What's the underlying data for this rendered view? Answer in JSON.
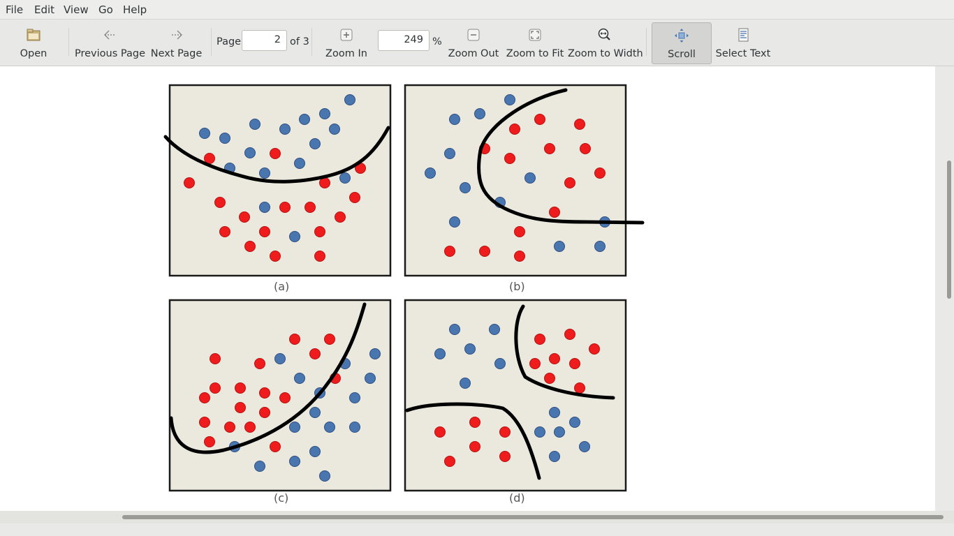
{
  "menu": {
    "items": [
      "File",
      "Edit",
      "View",
      "Go",
      "Help"
    ]
  },
  "toolbar": {
    "open": "Open",
    "prev_page": "Previous Page",
    "next_page": "Next Page",
    "page_label": "Page",
    "page_value": "2",
    "page_of": "of 3",
    "zoom_in": "Zoom In",
    "zoom_value": "249",
    "zoom_unit": "%",
    "zoom_out": "Zoom Out",
    "zoom_fit": "Zoom to Fit",
    "zoom_width": "Zoom to Width",
    "scroll": "Scroll",
    "select_text": "Select Text"
  },
  "figure": {
    "colors": {
      "blue": "#4a76b0",
      "red": "#ee1c1c",
      "panel_bg": "#ebe8de",
      "curve": "#000000"
    },
    "panels": [
      {
        "caption": "(a)"
      },
      {
        "caption": "(b)"
      },
      {
        "caption": "(c)"
      },
      {
        "caption": "(d)"
      }
    ]
  }
}
